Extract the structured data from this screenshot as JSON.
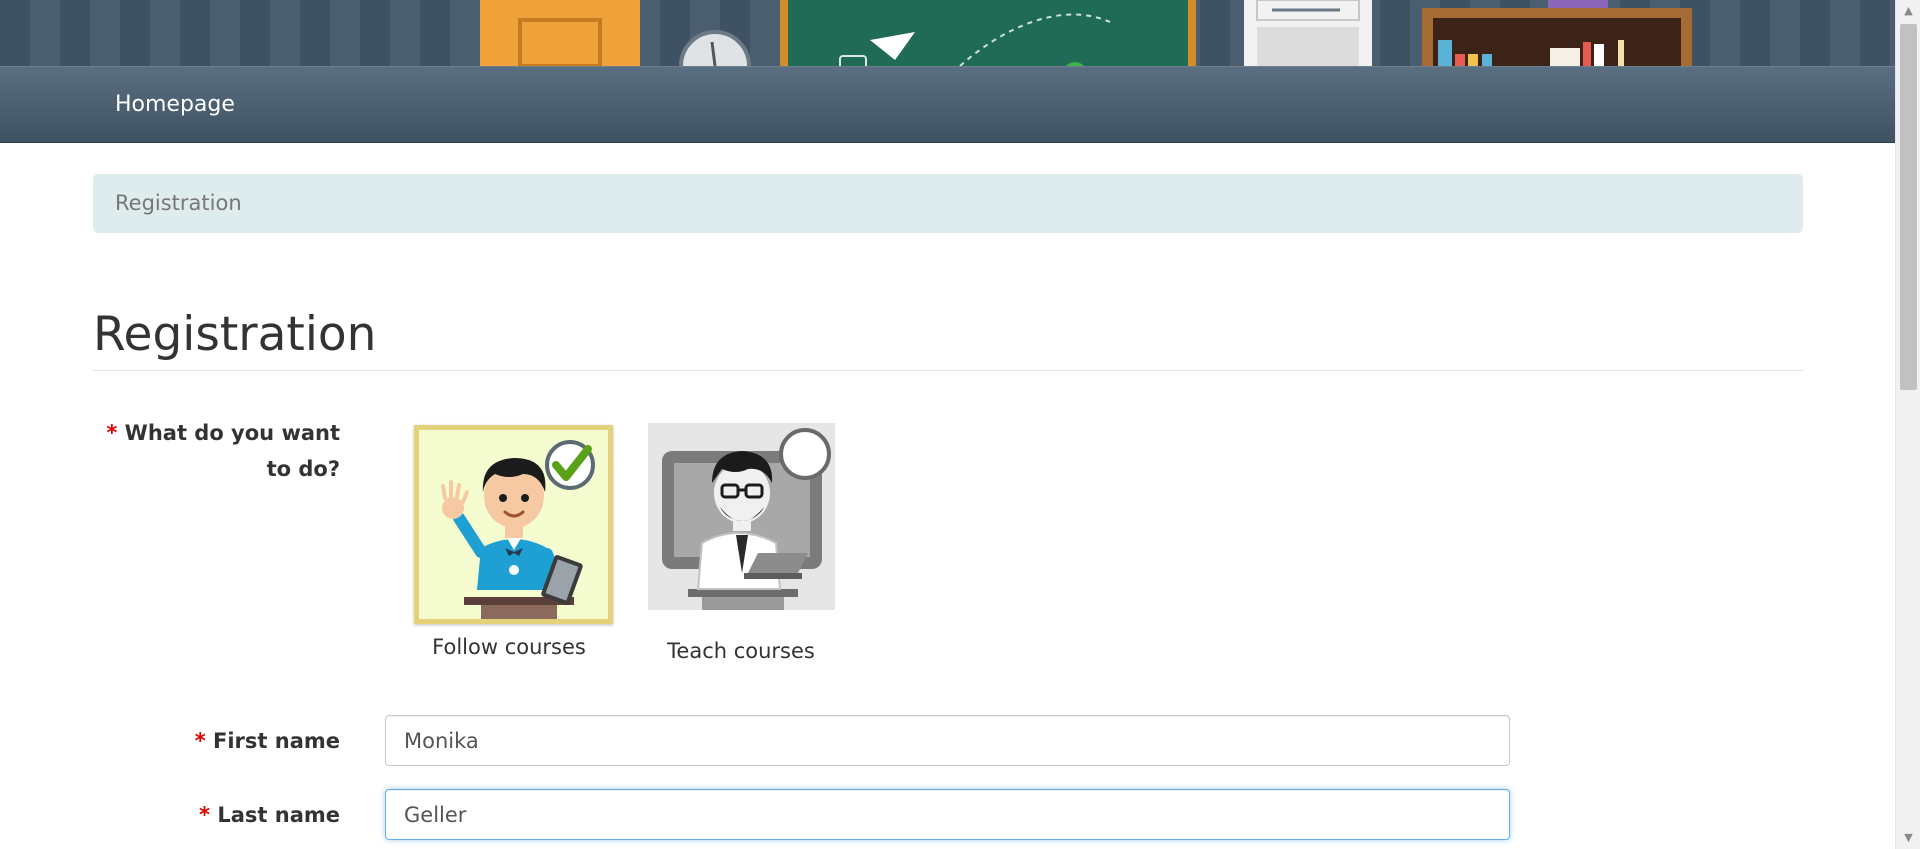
{
  "nav": {
    "home_label": "Homepage"
  },
  "breadcrumb": {
    "current": "Registration"
  },
  "page": {
    "title": "Registration"
  },
  "role_question": {
    "required_mark": "*",
    "label": "What do you want to do?",
    "options": [
      {
        "label": "Follow courses",
        "selected": true
      },
      {
        "label": "Teach courses",
        "selected": false
      }
    ]
  },
  "form": {
    "first_name": {
      "required_mark": "*",
      "label": "First name",
      "value": "Monika"
    },
    "last_name": {
      "required_mark": "*",
      "label": "Last name",
      "value": "Geller"
    }
  },
  "colors": {
    "navbar": "#4b5f71",
    "breadcrumb_bg": "#dfecee",
    "required": "#e20000",
    "selected_border": "#e4d27a",
    "check_green": "#5aa117",
    "focus_border": "#66afe9"
  }
}
